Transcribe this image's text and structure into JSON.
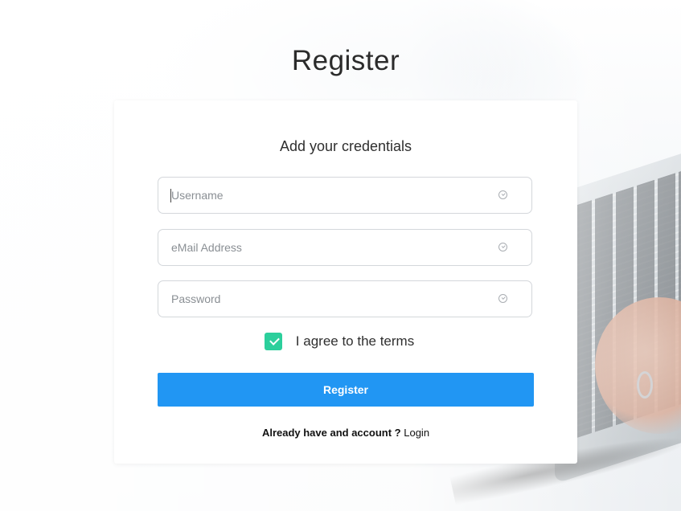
{
  "page": {
    "title": "Register"
  },
  "card": {
    "subtitle": "Add your credentials",
    "fields": {
      "username": {
        "placeholder": "Username",
        "value": ""
      },
      "email": {
        "placeholder": "eMail Address",
        "value": ""
      },
      "password": {
        "placeholder": "Password",
        "value": ""
      }
    },
    "terms": {
      "label": "I agree to the terms",
      "checked": true
    },
    "register_button_label": "Register",
    "login_prompt": "Already have and account ?",
    "login_link_label": "Login"
  },
  "colors": {
    "primary": "#2196f3",
    "checkbox": "#2ccf9c"
  },
  "icons": {
    "field_status": "check-circle-icon",
    "checkbox_mark": "checkmark-icon"
  }
}
